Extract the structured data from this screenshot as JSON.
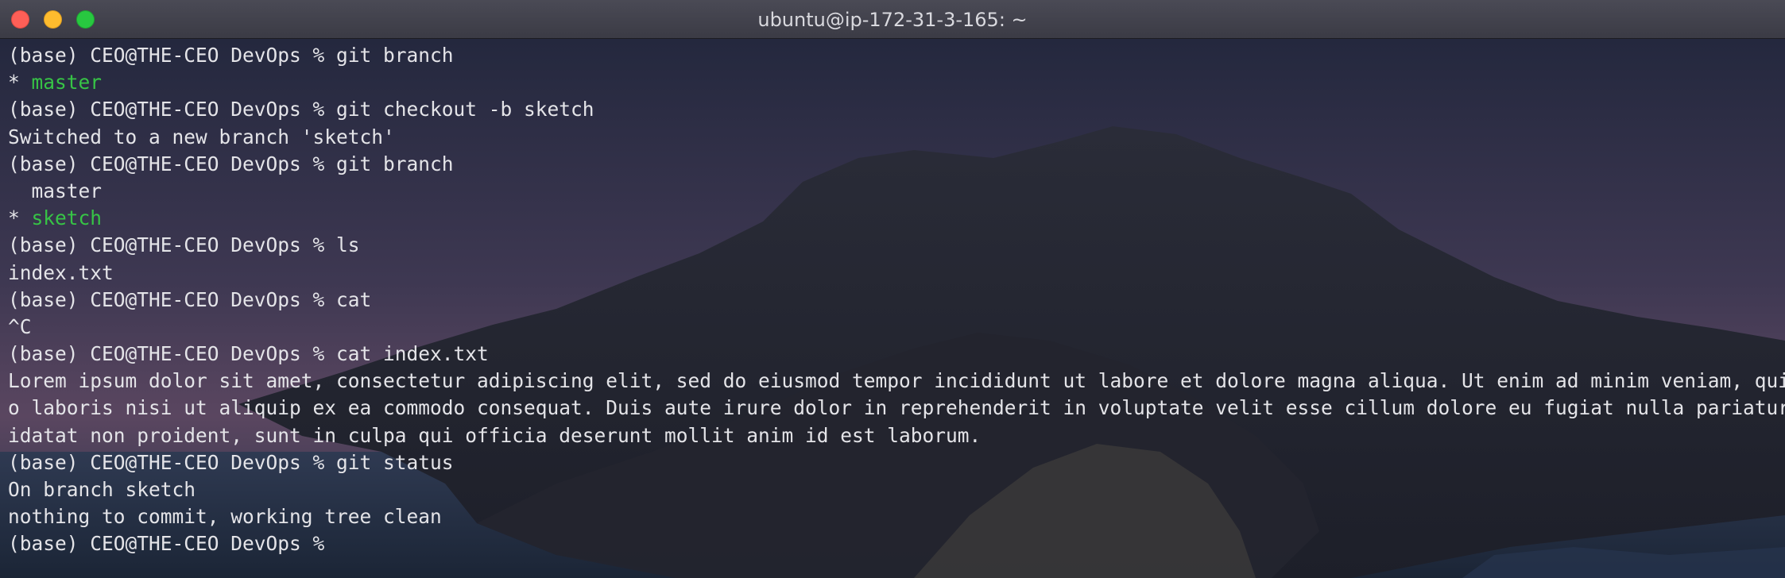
{
  "window": {
    "title": "ubuntu@ip-172-31-3-165: ~",
    "controls": [
      "close",
      "minimize",
      "maximize"
    ],
    "colors": {
      "close": "#fe5f57",
      "minimize": "#febc2e",
      "maximize": "#28c840",
      "branch_highlight": "#37c446",
      "text": "#e4e4e8"
    }
  },
  "terminal": {
    "lines": [
      {
        "prefix": "(base) CEO@THE-CEO DevOps % git branch",
        "highlight": ""
      },
      {
        "prefix": "* ",
        "highlight": "master"
      },
      {
        "prefix": "(base) CEO@THE-CEO DevOps % git checkout -b sketch",
        "highlight": ""
      },
      {
        "prefix": "Switched to a new branch 'sketch'",
        "highlight": ""
      },
      {
        "prefix": "(base) CEO@THE-CEO DevOps % git branch",
        "highlight": ""
      },
      {
        "prefix": "  master",
        "highlight": ""
      },
      {
        "prefix": "* ",
        "highlight": "sketch"
      },
      {
        "prefix": "(base) CEO@THE-CEO DevOps % ls",
        "highlight": ""
      },
      {
        "prefix": "index.txt",
        "highlight": ""
      },
      {
        "prefix": "(base) CEO@THE-CEO DevOps % cat",
        "highlight": ""
      },
      {
        "prefix": "^C",
        "highlight": ""
      },
      {
        "prefix": "(base) CEO@THE-CEO DevOps % cat index.txt",
        "highlight": ""
      },
      {
        "prefix": "Lorem ipsum dolor sit amet, consectetur adipiscing elit, sed do eiusmod tempor incididunt ut labore et dolore magna aliqua. Ut enim ad minim veniam, quis nostru",
        "highlight": ""
      },
      {
        "prefix": "o laboris nisi ut aliquip ex ea commodo consequat. Duis aute irure dolor in reprehenderit in voluptate velit esse cillum dolore eu fugiat nulla pariatur. Except",
        "highlight": ""
      },
      {
        "prefix": "idatat non proident, sunt in culpa qui officia deserunt mollit anim id est laborum.",
        "highlight": ""
      },
      {
        "prefix": "(base) CEO@THE-CEO DevOps % git status",
        "highlight": ""
      },
      {
        "prefix": "On branch sketch",
        "highlight": ""
      },
      {
        "prefix": "nothing to commit, working tree clean",
        "highlight": ""
      },
      {
        "prefix": "(base) CEO@THE-CEO DevOps % ",
        "highlight": ""
      }
    ]
  }
}
